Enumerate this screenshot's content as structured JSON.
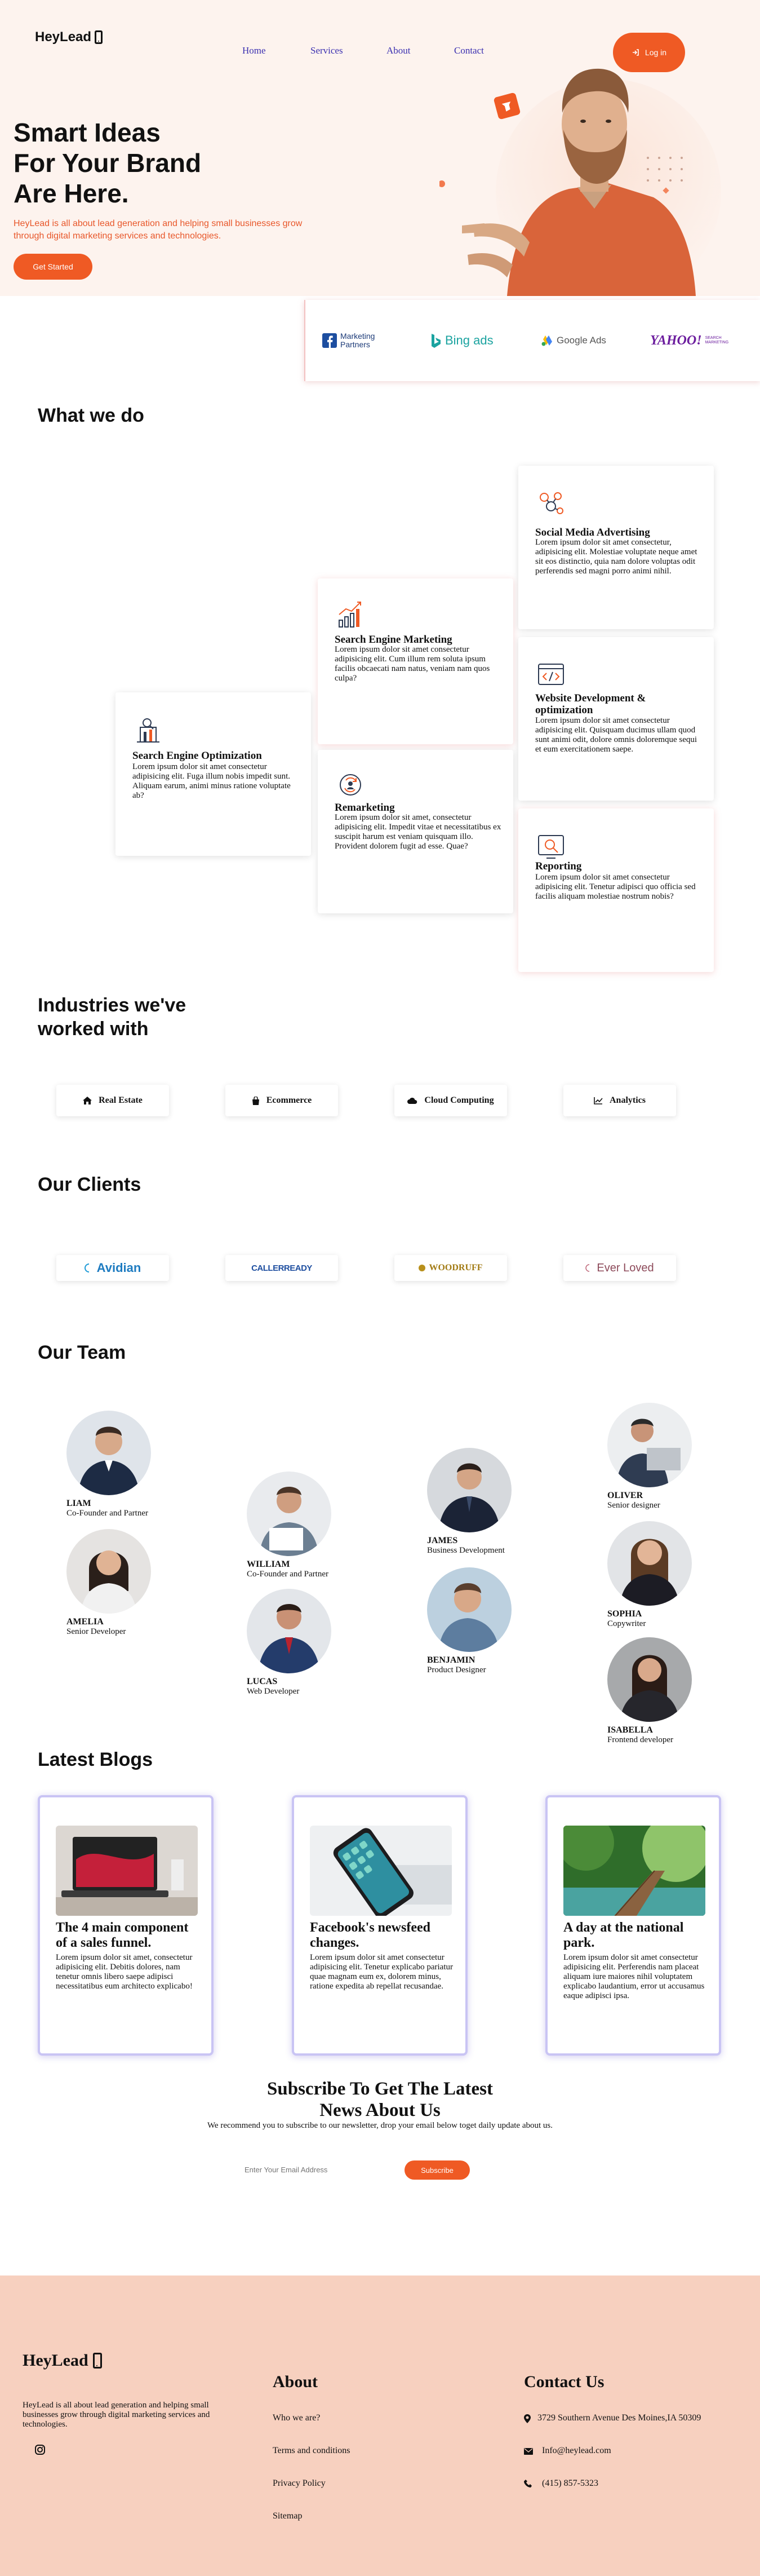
{
  "brand": {
    "name": "HeyLead",
    "accent": "#ef5a24"
  },
  "nav": {
    "home": "Home",
    "services": "Services",
    "about": "About",
    "contact": "Contact",
    "login": "Log in"
  },
  "hero": {
    "title_line1": "Smart Ideas",
    "title_line2": "For Your Brand",
    "title_line3": "Are Here.",
    "subtitle": "HeyLead is all about lead generation and helping small businesses grow through digital marketing services and technologies.",
    "cta": "Get Started"
  },
  "partners": {
    "facebook_line1": "Marketing",
    "facebook_line2": "Partners",
    "bing": "Bing ads",
    "google": "Google Ads",
    "yahoo": "YAHOO!",
    "yahoo_sub1": "SEARCH",
    "yahoo_sub2": "MARKETING"
  },
  "what_we_do": {
    "heading": "What we do",
    "services": [
      {
        "title": "Search Engine Optimization",
        "text": "Lorem ipsum dolor sit amet consectetur adipisicing elit. Fuga illum nobis impedit sunt. Aliquam earum, animi minus ratione voluptate ab?",
        "icon": "seo-icon"
      },
      {
        "title": "Search Engine Marketing",
        "text": "Lorem ipsum dolor sit amet consectetur adipisicing elit. Cum illum rem soluta ipsum facilis obcaecati nam natus, veniam nam quos culpa?",
        "icon": "growth-chart-icon"
      },
      {
        "title": "Remarketing",
        "text": "Lorem ipsum dolor sit amet, consectetur adipisicing elit. Impedit vitae et necessitatibus ex suscipit harum est veniam quisquam illo. Provident dolorem fugit ad esse. Quae?",
        "icon": "remarketing-icon"
      },
      {
        "title": "Social Media Advertising",
        "text": "Lorem ipsum dolor sit amet consectetur, adipisicing elit. Molestiae voluptate neque amet sit eos distinctio, quia nam dolore voluptas odit perferendis sed magni porro animi nihil.",
        "icon": "social-network-icon"
      },
      {
        "title": "Website Development & optimization",
        "text": "Lorem ipsum dolor sit amet consectetur adipisicing elit. Quisquam ducimus ullam quod sunt animi odit, dolore omnis doloremque sequi et eum exercitationem saepe.",
        "icon": "code-window-icon"
      },
      {
        "title": "Reporting",
        "text": "Lorem ipsum dolor sit amet consectetur adipisicing elit. Tenetur adipisci quo officia sed facilis aliquam molestiae nostrum nobis?",
        "icon": "report-icon"
      }
    ]
  },
  "industries": {
    "heading_line1": "Industries we've",
    "heading_line2": "worked with",
    "items": [
      {
        "label": "Real Estate",
        "icon": "home-icon"
      },
      {
        "label": "Ecommerce",
        "icon": "shopping-bag-icon"
      },
      {
        "label": "Cloud Computing",
        "icon": "cloud-icon"
      },
      {
        "label": "Analytics",
        "icon": "line-chart-icon"
      }
    ]
  },
  "clients": {
    "heading": "Our Clients",
    "items": [
      "Avidian",
      "CALLERREADY",
      "WOODRUFF",
      "Ever Loved"
    ]
  },
  "team": {
    "heading": "Our Team",
    "members": [
      {
        "name": "LIAM",
        "role": "Co-Founder and Partner"
      },
      {
        "name": "AMELIA",
        "role": "Senior Developer"
      },
      {
        "name": "WILLIAM",
        "role": "Co-Founder and Partner"
      },
      {
        "name": "LUCAS",
        "role": "Web Developer"
      },
      {
        "name": "JAMES",
        "role": "Business Development"
      },
      {
        "name": "BENJAMIN",
        "role": "Product Designer"
      },
      {
        "name": "OLIVER",
        "role": "Senior designer"
      },
      {
        "name": "SOPHIA",
        "role": "Copywriter"
      },
      {
        "name": "ISABELLA",
        "role": "Frontend developer"
      }
    ]
  },
  "blogs": {
    "heading": "Latest Blogs",
    "posts": [
      {
        "title": "The 4 main component of a sales funnel.",
        "text": "Lorem ipsum dolor sit amet, consectetur adipisicing elit. Debitis dolores, nam tenetur omnis libero saepe adipisci necessitatibus eum architecto explicabo!"
      },
      {
        "title": "Facebook's newsfeed changes.",
        "text": "Lorem ipsum dolor sit amet consectetur adipisicing elit. Tenetur explicabo pariatur quae magnam eum ex, dolorem minus, ratione expedita ab repellat recusandae."
      },
      {
        "title": "A day at the national park.",
        "text": "Lorem ipsum dolor sit amet consectetur adipisicing elit. Perferendis nam placeat aliquam iure maiores nihil voluptatem explicabo laudantium, error ut accusamus eaque adipisci ipsa."
      }
    ]
  },
  "subscribe": {
    "heading_line1": "Subscribe To Get The Latest",
    "heading_line2": "News About Us",
    "text": "We recommend you to subscribe to our newsletter, drop your email below toget daily update about us.",
    "placeholder": "Enter Your Email Address",
    "button": "Subscribe"
  },
  "footer": {
    "description": "HeyLead is all about lead generation and helping small businesses grow through digital marketing services and technologies.",
    "about_heading": "About",
    "about_links": [
      "Who we are?",
      "Terms and conditions",
      "Privacy Policy",
      "Sitemap"
    ],
    "contact_heading": "Contact Us",
    "address": "3729 Southern Avenue Des Moines,IA 50309",
    "email": "Info@heylead.com",
    "phone": "(415) 857-5323"
  }
}
